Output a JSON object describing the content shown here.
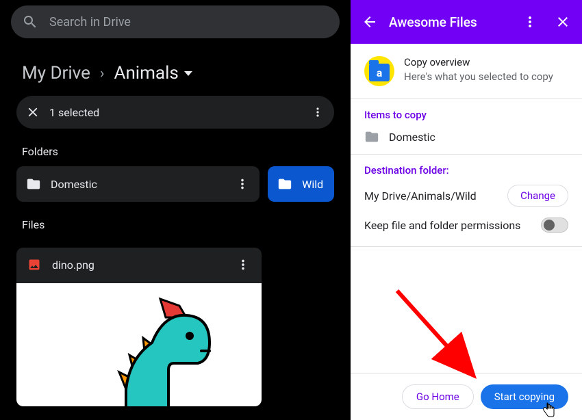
{
  "search": {
    "placeholder": "Search in Drive"
  },
  "breadcrumb": {
    "root": "My Drive",
    "current": "Animals"
  },
  "selection": {
    "text": "1 selected"
  },
  "sections": {
    "folders": "Folders",
    "files": "Files"
  },
  "folders": [
    {
      "name": "Domestic"
    },
    {
      "name": "Wild"
    }
  ],
  "file": {
    "name": "dino.png"
  },
  "panel": {
    "title": "Awesome Files",
    "overview": {
      "title": "Copy overview",
      "subtitle": "Here's what you selected to copy"
    },
    "items_title": "Items to copy",
    "items": [
      {
        "name": "Domestic"
      }
    ],
    "dest_title": "Destination folder:",
    "dest_path": "My Drive/Animals/Wild",
    "change": "Change",
    "perm_label": "Keep file and folder permissions",
    "go_home": "Go Home",
    "start": "Start copying"
  }
}
